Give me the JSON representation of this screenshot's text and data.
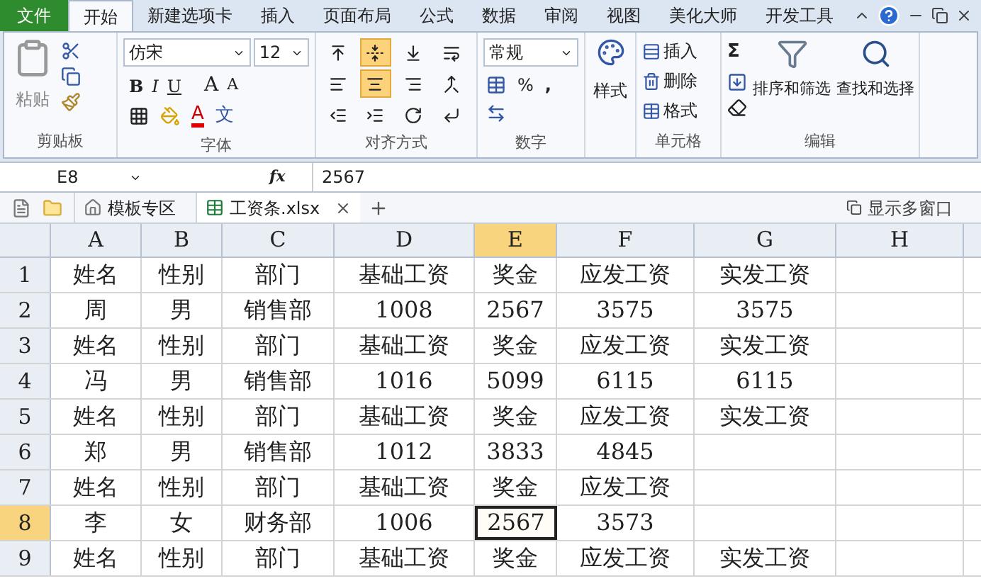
{
  "menu_tabs": [
    {
      "label": "文件",
      "kind": "file",
      "selected": false
    },
    {
      "label": "开始",
      "kind": "tab",
      "selected": true
    },
    {
      "label": "新建选项卡",
      "kind": "tab",
      "selected": false
    },
    {
      "label": "插入",
      "kind": "tab",
      "selected": false
    },
    {
      "label": "页面布局",
      "kind": "tab",
      "selected": false
    },
    {
      "label": "公式",
      "kind": "tab",
      "selected": false
    },
    {
      "label": "数据",
      "kind": "tab",
      "selected": false
    },
    {
      "label": "审阅",
      "kind": "tab",
      "selected": false
    },
    {
      "label": "视图",
      "kind": "tab",
      "selected": false
    },
    {
      "label": "美化大师",
      "kind": "tab",
      "selected": false
    },
    {
      "label": "开发工具",
      "kind": "tab",
      "selected": false
    }
  ],
  "ribbon": {
    "clipboard": {
      "paste": "粘贴",
      "label": "剪贴板"
    },
    "font": {
      "name": "仿宋",
      "size": "12",
      "bold": "B",
      "italic": "I",
      "underline": "U",
      "grow": "A",
      "shrink": "A",
      "font_color": "A",
      "phonetic": "文",
      "label": "字体"
    },
    "alignment": {
      "label": "对齐方式",
      "buttons": [
        {
          "kind": "top",
          "selected": false
        },
        {
          "kind": "middle",
          "selected": true
        },
        {
          "kind": "bottom",
          "selected": false
        },
        {
          "kind": "wrap",
          "selected": false
        },
        {
          "kind": "left",
          "selected": false
        },
        {
          "kind": "center",
          "selected": true
        },
        {
          "kind": "right",
          "selected": false
        },
        {
          "kind": "merge",
          "selected": false
        },
        {
          "kind": "outdent",
          "selected": false
        },
        {
          "kind": "indent",
          "selected": false
        },
        {
          "kind": "orient",
          "selected": false
        },
        {
          "kind": "rtl",
          "selected": false
        }
      ]
    },
    "number": {
      "format": "常规",
      "percent": "%",
      "comma": ",",
      "label": "数字"
    },
    "styles": {
      "button": "样式"
    },
    "cells": {
      "items": [
        "插入",
        "删除",
        "格式"
      ],
      "label": "单元格"
    },
    "editing": {
      "sigma": "Σ",
      "sort": "排序和筛选",
      "find": "查找和选择",
      "label": "编辑"
    }
  },
  "formula_bar": {
    "name_box": "E8",
    "fx": "fx",
    "value": "2567"
  },
  "doc_tabs": {
    "items": [
      {
        "label": "模板专区",
        "kind": "template",
        "selected": false
      },
      {
        "label": "工资条.xlsx",
        "kind": "file",
        "selected": true
      }
    ],
    "multi_window": "显示多窗口"
  },
  "sheet": {
    "columns": [
      {
        "label": "A",
        "selected": false
      },
      {
        "label": "B",
        "selected": false
      },
      {
        "label": "C",
        "selected": false
      },
      {
        "label": "D",
        "selected": false
      },
      {
        "label": "E",
        "selected": true
      },
      {
        "label": "F",
        "selected": false
      },
      {
        "label": "G",
        "selected": false
      },
      {
        "label": "H",
        "selected": false
      }
    ],
    "rows": [
      {
        "number": "1",
        "selected": false,
        "cells": [
          {
            "text": "姓名",
            "selected": false
          },
          {
            "text": "性别",
            "selected": false
          },
          {
            "text": "部门",
            "selected": false
          },
          {
            "text": "基础工资",
            "selected": false
          },
          {
            "text": "奖金",
            "selected": false
          },
          {
            "text": "应发工资",
            "selected": false
          },
          {
            "text": "实发工资",
            "selected": false
          }
        ]
      },
      {
        "number": "2",
        "selected": false,
        "cells": [
          {
            "text": "周",
            "selected": false
          },
          {
            "text": "男",
            "selected": false
          },
          {
            "text": "销售部",
            "selected": false
          },
          {
            "text": "1008",
            "selected": false
          },
          {
            "text": "2567",
            "selected": false
          },
          {
            "text": "3575",
            "selected": false
          },
          {
            "text": "3575",
            "selected": false
          }
        ]
      },
      {
        "number": "3",
        "selected": false,
        "cells": [
          {
            "text": "姓名",
            "selected": false
          },
          {
            "text": "性别",
            "selected": false
          },
          {
            "text": "部门",
            "selected": false
          },
          {
            "text": "基础工资",
            "selected": false
          },
          {
            "text": "奖金",
            "selected": false
          },
          {
            "text": "应发工资",
            "selected": false
          },
          {
            "text": "实发工资",
            "selected": false
          }
        ]
      },
      {
        "number": "4",
        "selected": false,
        "cells": [
          {
            "text": "冯",
            "selected": false
          },
          {
            "text": "男",
            "selected": false
          },
          {
            "text": "销售部",
            "selected": false
          },
          {
            "text": "1016",
            "selected": false
          },
          {
            "text": "5099",
            "selected": false
          },
          {
            "text": "6115",
            "selected": false
          },
          {
            "text": "6115",
            "selected": false
          }
        ]
      },
      {
        "number": "5",
        "selected": false,
        "cells": [
          {
            "text": "姓名",
            "selected": false
          },
          {
            "text": "性别",
            "selected": false
          },
          {
            "text": "部门",
            "selected": false
          },
          {
            "text": "基础工资",
            "selected": false
          },
          {
            "text": "奖金",
            "selected": false
          },
          {
            "text": "应发工资",
            "selected": false
          },
          {
            "text": "实发工资",
            "selected": false
          }
        ]
      },
      {
        "number": "6",
        "selected": false,
        "cells": [
          {
            "text": "郑",
            "selected": false
          },
          {
            "text": "男",
            "selected": false
          },
          {
            "text": "销售部",
            "selected": false
          },
          {
            "text": "1012",
            "selected": false
          },
          {
            "text": "3833",
            "selected": false
          },
          {
            "text": "4845",
            "selected": false
          }
        ]
      },
      {
        "number": "7",
        "selected": false,
        "cells": [
          {
            "text": "姓名",
            "selected": false
          },
          {
            "text": "性别",
            "selected": false
          },
          {
            "text": "部门",
            "selected": false
          },
          {
            "text": "基础工资",
            "selected": false
          },
          {
            "text": "奖金",
            "selected": false
          },
          {
            "text": "应发工资",
            "selected": false
          }
        ]
      },
      {
        "number": "8",
        "selected": true,
        "cells": [
          {
            "text": "李",
            "selected": false
          },
          {
            "text": "女",
            "selected": false
          },
          {
            "text": "财务部",
            "selected": false
          },
          {
            "text": "1006",
            "selected": false
          },
          {
            "text": "2567",
            "selected": true
          },
          {
            "text": "3573",
            "selected": false
          }
        ]
      },
      {
        "number": "9",
        "selected": false,
        "cells": [
          {
            "text": "姓名",
            "selected": false
          },
          {
            "text": "性别",
            "selected": false
          },
          {
            "text": "部门",
            "selected": false
          },
          {
            "text": "基础工资",
            "selected": false
          },
          {
            "text": "奖金",
            "selected": false
          },
          {
            "text": "应发工资",
            "selected": false
          },
          {
            "text": "实发工资",
            "selected": false
          }
        ]
      }
    ]
  }
}
